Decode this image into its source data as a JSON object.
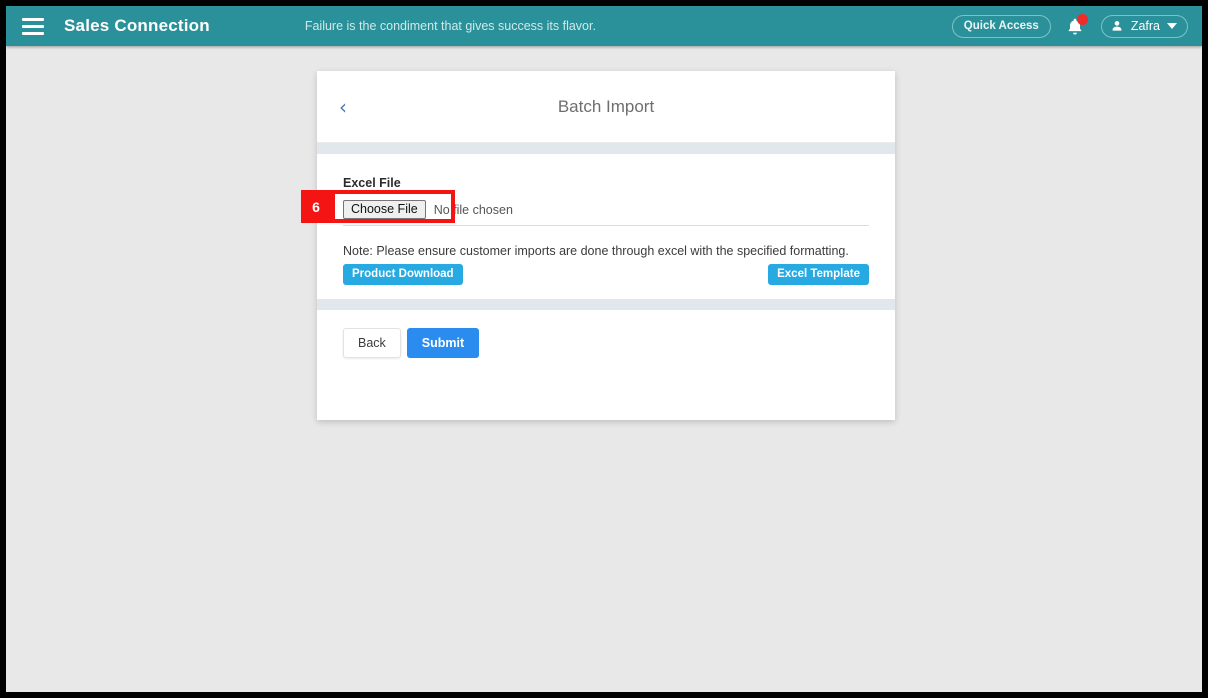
{
  "navbar": {
    "menu_icon": "hamburger-icon",
    "brand": "Sales Connection",
    "tagline": "Failure is the condiment that gives success its flavor.",
    "quick_access_label": "Quick Access",
    "bell_icon": "bell-icon",
    "user_name": "Zafra",
    "user_icon": "user-icon",
    "caret_icon": "chevron-down-icon",
    "background_color": "#2a9099"
  },
  "card": {
    "back_icon": "chevron-left-icon",
    "title": "Batch Import",
    "form": {
      "excel_file_label": "Excel File",
      "choose_file_button": "Choose File",
      "no_file_text": "No file chosen",
      "note": "Note: Please ensure customer imports are done through excel with the specified formatting.",
      "product_download_label": "Product Download",
      "excel_template_label": "Excel Template"
    },
    "footer": {
      "back_label": "Back",
      "submit_label": "Submit"
    }
  },
  "annotation": {
    "step_number": "6",
    "color": "#f41414"
  }
}
